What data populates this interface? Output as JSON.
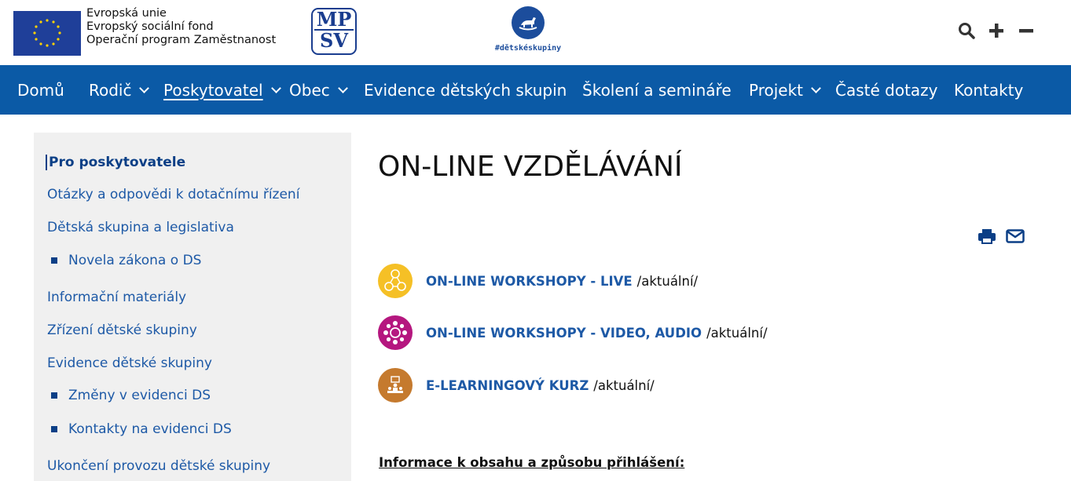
{
  "header": {
    "eu_text": [
      "Evropská unie",
      "Evropský sociální fond",
      "Operační program Zaměstnanost"
    ],
    "mpsv_logo": [
      "MP",
      "SV"
    ],
    "ds_logo_tag": "#dětskéskupiny",
    "tools": [
      {
        "icon": "search-icon"
      },
      {
        "icon": "plus-icon"
      },
      {
        "icon": "minus-icon"
      }
    ]
  },
  "nav": {
    "items": [
      {
        "label": "Domů",
        "dropdown": false
      },
      {
        "label": "Rodič",
        "dropdown": true
      },
      {
        "label": "Poskytovatel",
        "dropdown": true,
        "active": true
      },
      {
        "label": "Obec",
        "dropdown": true
      },
      {
        "label": "Evidence dětských skupin",
        "dropdown": false
      },
      {
        "label": "Školení a semináře",
        "dropdown": false
      },
      {
        "label": "Projekt",
        "dropdown": true
      },
      {
        "label": "Časté dotazy",
        "dropdown": false
      },
      {
        "label": "Kontakty",
        "dropdown": false
      }
    ]
  },
  "sidebar": {
    "items": [
      {
        "label": "Pro poskytovatele",
        "level": 0,
        "current": true
      },
      {
        "label": "Otázky a odpovědi k dotačnímu řízení",
        "level": 0
      },
      {
        "label": "Dětská skupina a legislativa",
        "level": 0
      },
      {
        "label": "Novela zákona o DS",
        "level": 1
      },
      {
        "label": "Informační materiály",
        "level": 0
      },
      {
        "label": "Zřízení dětské skupiny",
        "level": 0
      },
      {
        "label": "Evidence dětské skupiny",
        "level": 0
      },
      {
        "label": "Změny v evidenci DS",
        "level": 1
      },
      {
        "label": "Kontakty na evidenci DS",
        "level": 1
      },
      {
        "label": "Ukončení provozu dětské skupiny",
        "level": 0
      }
    ]
  },
  "main": {
    "title": "ON-LINE VZDĚLÁVÁNÍ",
    "actions": [
      {
        "icon": "print-icon"
      },
      {
        "icon": "mail-icon"
      }
    ],
    "rows": [
      {
        "link": "ON-LINE WORKSHOPY - LIVE",
        "suffix": "/aktuální/",
        "color": "#f5c026",
        "icon": "people-network-icon"
      },
      {
        "link": "ON-LINE WORKSHOPY - VIDEO, AUDIO",
        "suffix": "/aktuální/",
        "color": "#b5177f",
        "icon": "people-circle-icon"
      },
      {
        "link": "E-LEARNINGOVÝ KURZ",
        "suffix": "/aktuální/",
        "color": "#c57a2e",
        "icon": "presentation-icon"
      }
    ],
    "info_heading": "Informace k obsahu a způsobu přihlášení:"
  },
  "colors": {
    "nav_bg": "#0b5aa6",
    "link": "#1d59a6",
    "sidebar_bg": "#f0f0f0"
  }
}
